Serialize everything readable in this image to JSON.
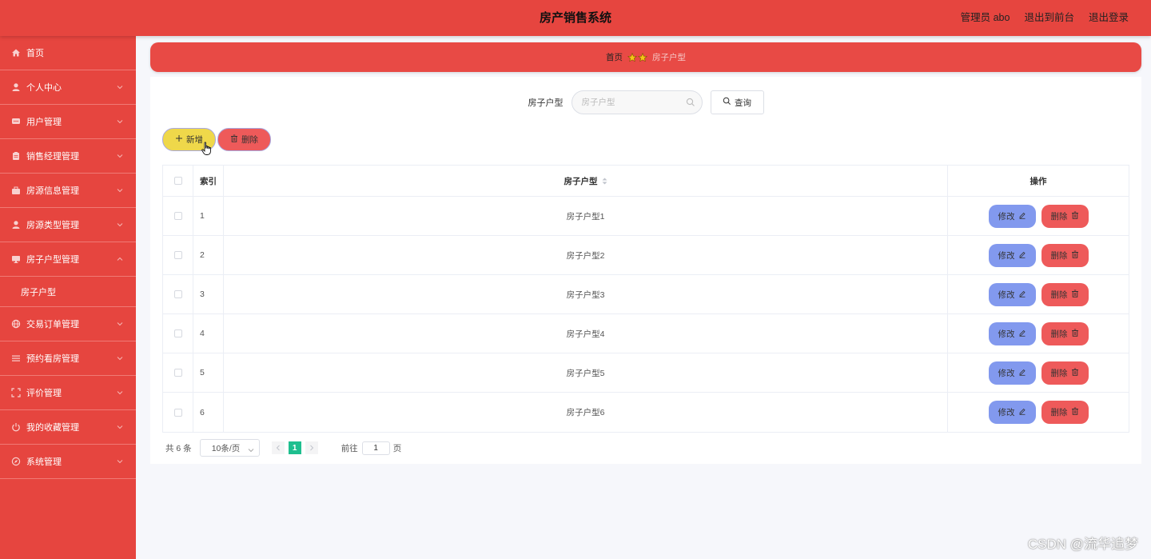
{
  "header": {
    "title": "房产销售系统",
    "admin_label": "管理员 abo",
    "front_link": "退出到前台",
    "logout": "退出登录"
  },
  "sidebar": {
    "items": [
      {
        "label": "首页",
        "icon": "home-icon"
      },
      {
        "label": "个人中心",
        "icon": "user-icon"
      },
      {
        "label": "用户管理",
        "icon": "chat-icon"
      },
      {
        "label": "销售经理管理",
        "icon": "briefcase-icon"
      },
      {
        "label": "房源信息管理",
        "icon": "suitcase-icon"
      },
      {
        "label": "房源类型管理",
        "icon": "person-icon"
      },
      {
        "label": "房子户型管理",
        "icon": "monitor-icon"
      },
      {
        "label": "交易订单管理",
        "icon": "globe-icon"
      },
      {
        "label": "预约看房管理",
        "icon": "list-icon"
      },
      {
        "label": "评价管理",
        "icon": "frame-icon"
      },
      {
        "label": "我的收藏管理",
        "icon": "power-icon"
      },
      {
        "label": "系统管理",
        "icon": "compass-icon"
      }
    ],
    "sub_item": "房子户型"
  },
  "breadcrumb": {
    "home": "首页",
    "current": "房子户型"
  },
  "search": {
    "label": "房子户型",
    "placeholder": "房子户型",
    "button": "查询"
  },
  "actions": {
    "add": "新增",
    "delete": "删除"
  },
  "table": {
    "headers": {
      "index": "索引",
      "type": "房子户型",
      "ops": "操作"
    },
    "rows": [
      {
        "index": "1",
        "type": "房子户型1"
      },
      {
        "index": "2",
        "type": "房子户型2"
      },
      {
        "index": "3",
        "type": "房子户型3"
      },
      {
        "index": "4",
        "type": "房子户型4"
      },
      {
        "index": "5",
        "type": "房子户型5"
      },
      {
        "index": "6",
        "type": "房子户型6"
      }
    ],
    "edit_label": "修改",
    "delete_label": "删除"
  },
  "pagination": {
    "total": "共 6 条",
    "page_size": "10条/页",
    "current_page": "1",
    "goto_label": "前往",
    "goto_value": "1",
    "page_suffix": "页"
  },
  "watermark": "CSDN @流华追梦",
  "colors": {
    "primary": "#e6453f",
    "add_button": "#efd84a",
    "edit_button": "#8299ee",
    "delete_button": "#ee5a5a",
    "active_page": "#1fbf8f"
  }
}
